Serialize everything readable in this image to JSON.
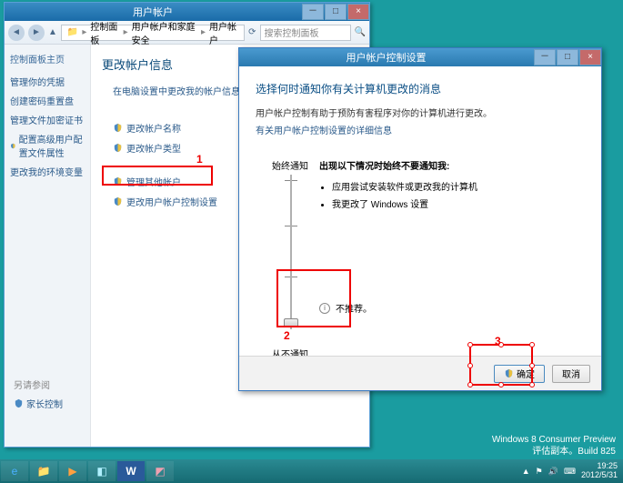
{
  "main_window": {
    "title": "用户帐户",
    "breadcrumb": [
      "控制面板",
      "用户帐户和家庭安全",
      "用户帐户"
    ],
    "search_placeholder": "搜索控制面板"
  },
  "sidebar": {
    "home": "控制面板主页",
    "items": [
      "管理你的凭据",
      "创建密码重置盘",
      "管理文件加密证书",
      "配置高级用户配置文件属性",
      "更改我的环境变量"
    ],
    "see_also_title": "另请参阅",
    "see_also": "家长控制"
  },
  "main_pane": {
    "heading": "更改帐户信息",
    "sub_desc": "在电脑设置中更改我的帐户信息",
    "actions": [
      "更改帐户名称",
      "更改帐户类型",
      "管理其他帐户",
      "更改用户帐户控制设置"
    ]
  },
  "annotations": {
    "a1": "1",
    "a2": "2",
    "a3": "3"
  },
  "uac": {
    "title": "用户帐户控制设置",
    "heading": "选择何时通知你有关计算机更改的消息",
    "desc": "用户帐户控制有助于预防有害程序对你的计算机进行更改。",
    "more_link": "有关用户帐户控制设置的详细信息",
    "slider_top": "始终通知",
    "slider_bottom": "从不通知",
    "info_title": "出现以下情况时始终不要通知我:",
    "info_items": [
      "应用尝试安装软件或更改我的计算机",
      "我更改了 Windows 设置"
    ],
    "not_recommended": "不推荐。",
    "ok": "确定",
    "cancel": "取消"
  },
  "watermark": {
    "line1": "Windows 8 Consumer Preview",
    "line2": "评估副本。Build 825"
  },
  "taskbar": {
    "time": "19:25",
    "date": "2012/5/31"
  }
}
